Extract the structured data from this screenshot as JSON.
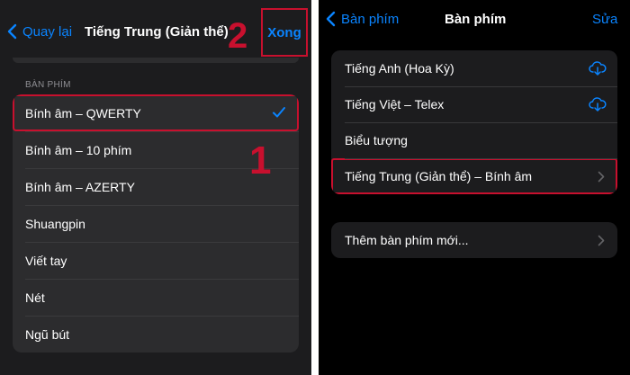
{
  "left": {
    "nav": {
      "back_label": "Quay lại",
      "title": "Tiếng Trung (Giản thể)",
      "done_label": "Xong"
    },
    "step_labels": {
      "one": "1",
      "two": "2"
    },
    "section_header": "BÀN PHÍM",
    "items": [
      {
        "label": "Bính âm – QWERTY",
        "selected": true
      },
      {
        "label": "Bính âm – 10 phím"
      },
      {
        "label": "Bính âm – AZERTY"
      },
      {
        "label": "Shuangpin"
      },
      {
        "label": "Viết tay"
      },
      {
        "label": "Nét"
      },
      {
        "label": "Ngũ bút"
      }
    ]
  },
  "right": {
    "nav": {
      "back_label": "Bàn phím",
      "title": "Bàn phím",
      "edit_label": "Sửa"
    },
    "keyboards": [
      {
        "label": "Tiếng Anh (Hoa Kỳ)",
        "icon": "cloud-download-icon"
      },
      {
        "label": "Tiếng Việt – Telex",
        "icon": "cloud-download-icon"
      },
      {
        "label": "Biểu tượng"
      },
      {
        "label": "Tiếng Trung (Giản thể) – Bính âm",
        "icon": "chevron-right-icon"
      }
    ],
    "add_keyboard_label": "Thêm bàn phím mới..."
  },
  "colors": {
    "accent": "#0a84ff",
    "annotation": "#c8102e",
    "sheet_bg": "#1c1c1e",
    "cell_bg": "#2c2c2e",
    "screen_bg": "#000000"
  }
}
